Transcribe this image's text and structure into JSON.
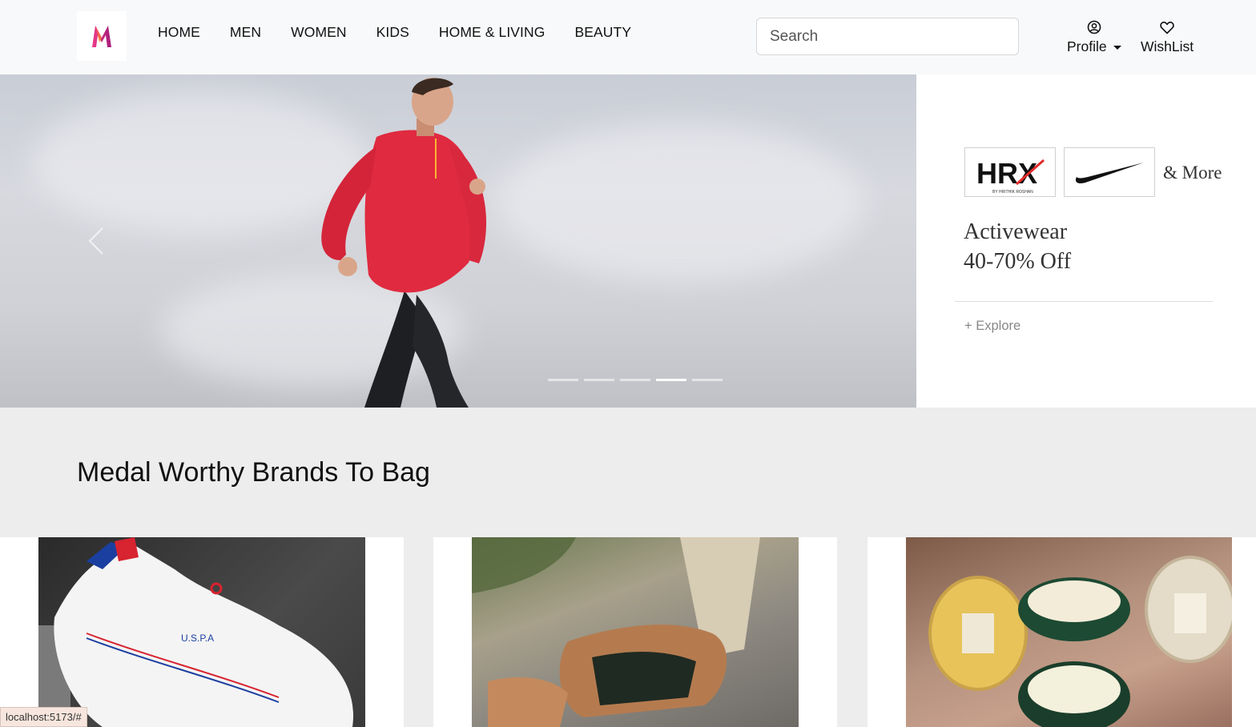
{
  "header": {
    "logo_icon": "myntra-logo-icon",
    "nav": [
      "HOME",
      "MEN",
      "WOMEN",
      "KIDS",
      "HOME & LIVING",
      "BEAUTY"
    ],
    "search_placeholder": "Search",
    "profile_label": "Profile",
    "wishlist_label": "WishList"
  },
  "hero": {
    "slide_count": 5,
    "active_slide": 4
  },
  "promo": {
    "brands": [
      "HRX",
      "Nike"
    ],
    "and_more": "& More",
    "title_line1": "Activewear",
    "title_line2": "40-70% Off",
    "explore": "+ Explore"
  },
  "section": {
    "title": "Medal Worthy Brands To Bag"
  },
  "status": {
    "url": "localhost:5173/#"
  },
  "colors": {
    "header_bg": "#f8f9fa",
    "section_bg": "#ededed",
    "logo_pink": "#ff3f6c",
    "logo_orange": "#f7931e"
  }
}
